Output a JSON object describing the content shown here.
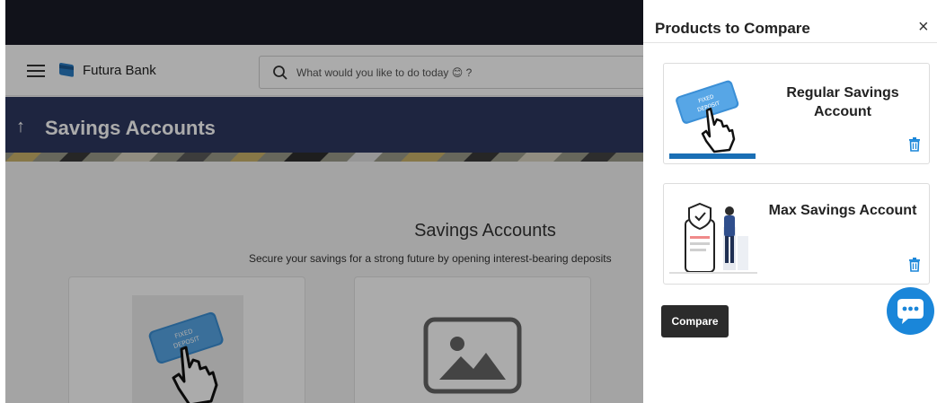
{
  "app": {
    "brand": "Futura Bank",
    "search_placeholder": "What would you like to do today 😊 ?"
  },
  "banner": {
    "back_arrow": "↑",
    "title": "Savings Accounts"
  },
  "main": {
    "heading": "Savings Accounts",
    "subheading": "Secure your savings for a strong future by opening interest-bearing deposits"
  },
  "compare_panel": {
    "title": "Products to Compare",
    "close_glyph": "×",
    "products": [
      {
        "name": "Regular Savings Account",
        "image_icon": "fixed-deposit-hand-icon"
      },
      {
        "name": "Max Savings Account",
        "image_icon": "phone-security-illustration-icon"
      }
    ],
    "compare_label": "Compare"
  },
  "colors": {
    "topbar": "#1a1b28",
    "banner": "#2e3860",
    "compare_button": "#2b2b2b",
    "chat_button": "#1a86d9",
    "trash_icon": "#1a86d9"
  }
}
